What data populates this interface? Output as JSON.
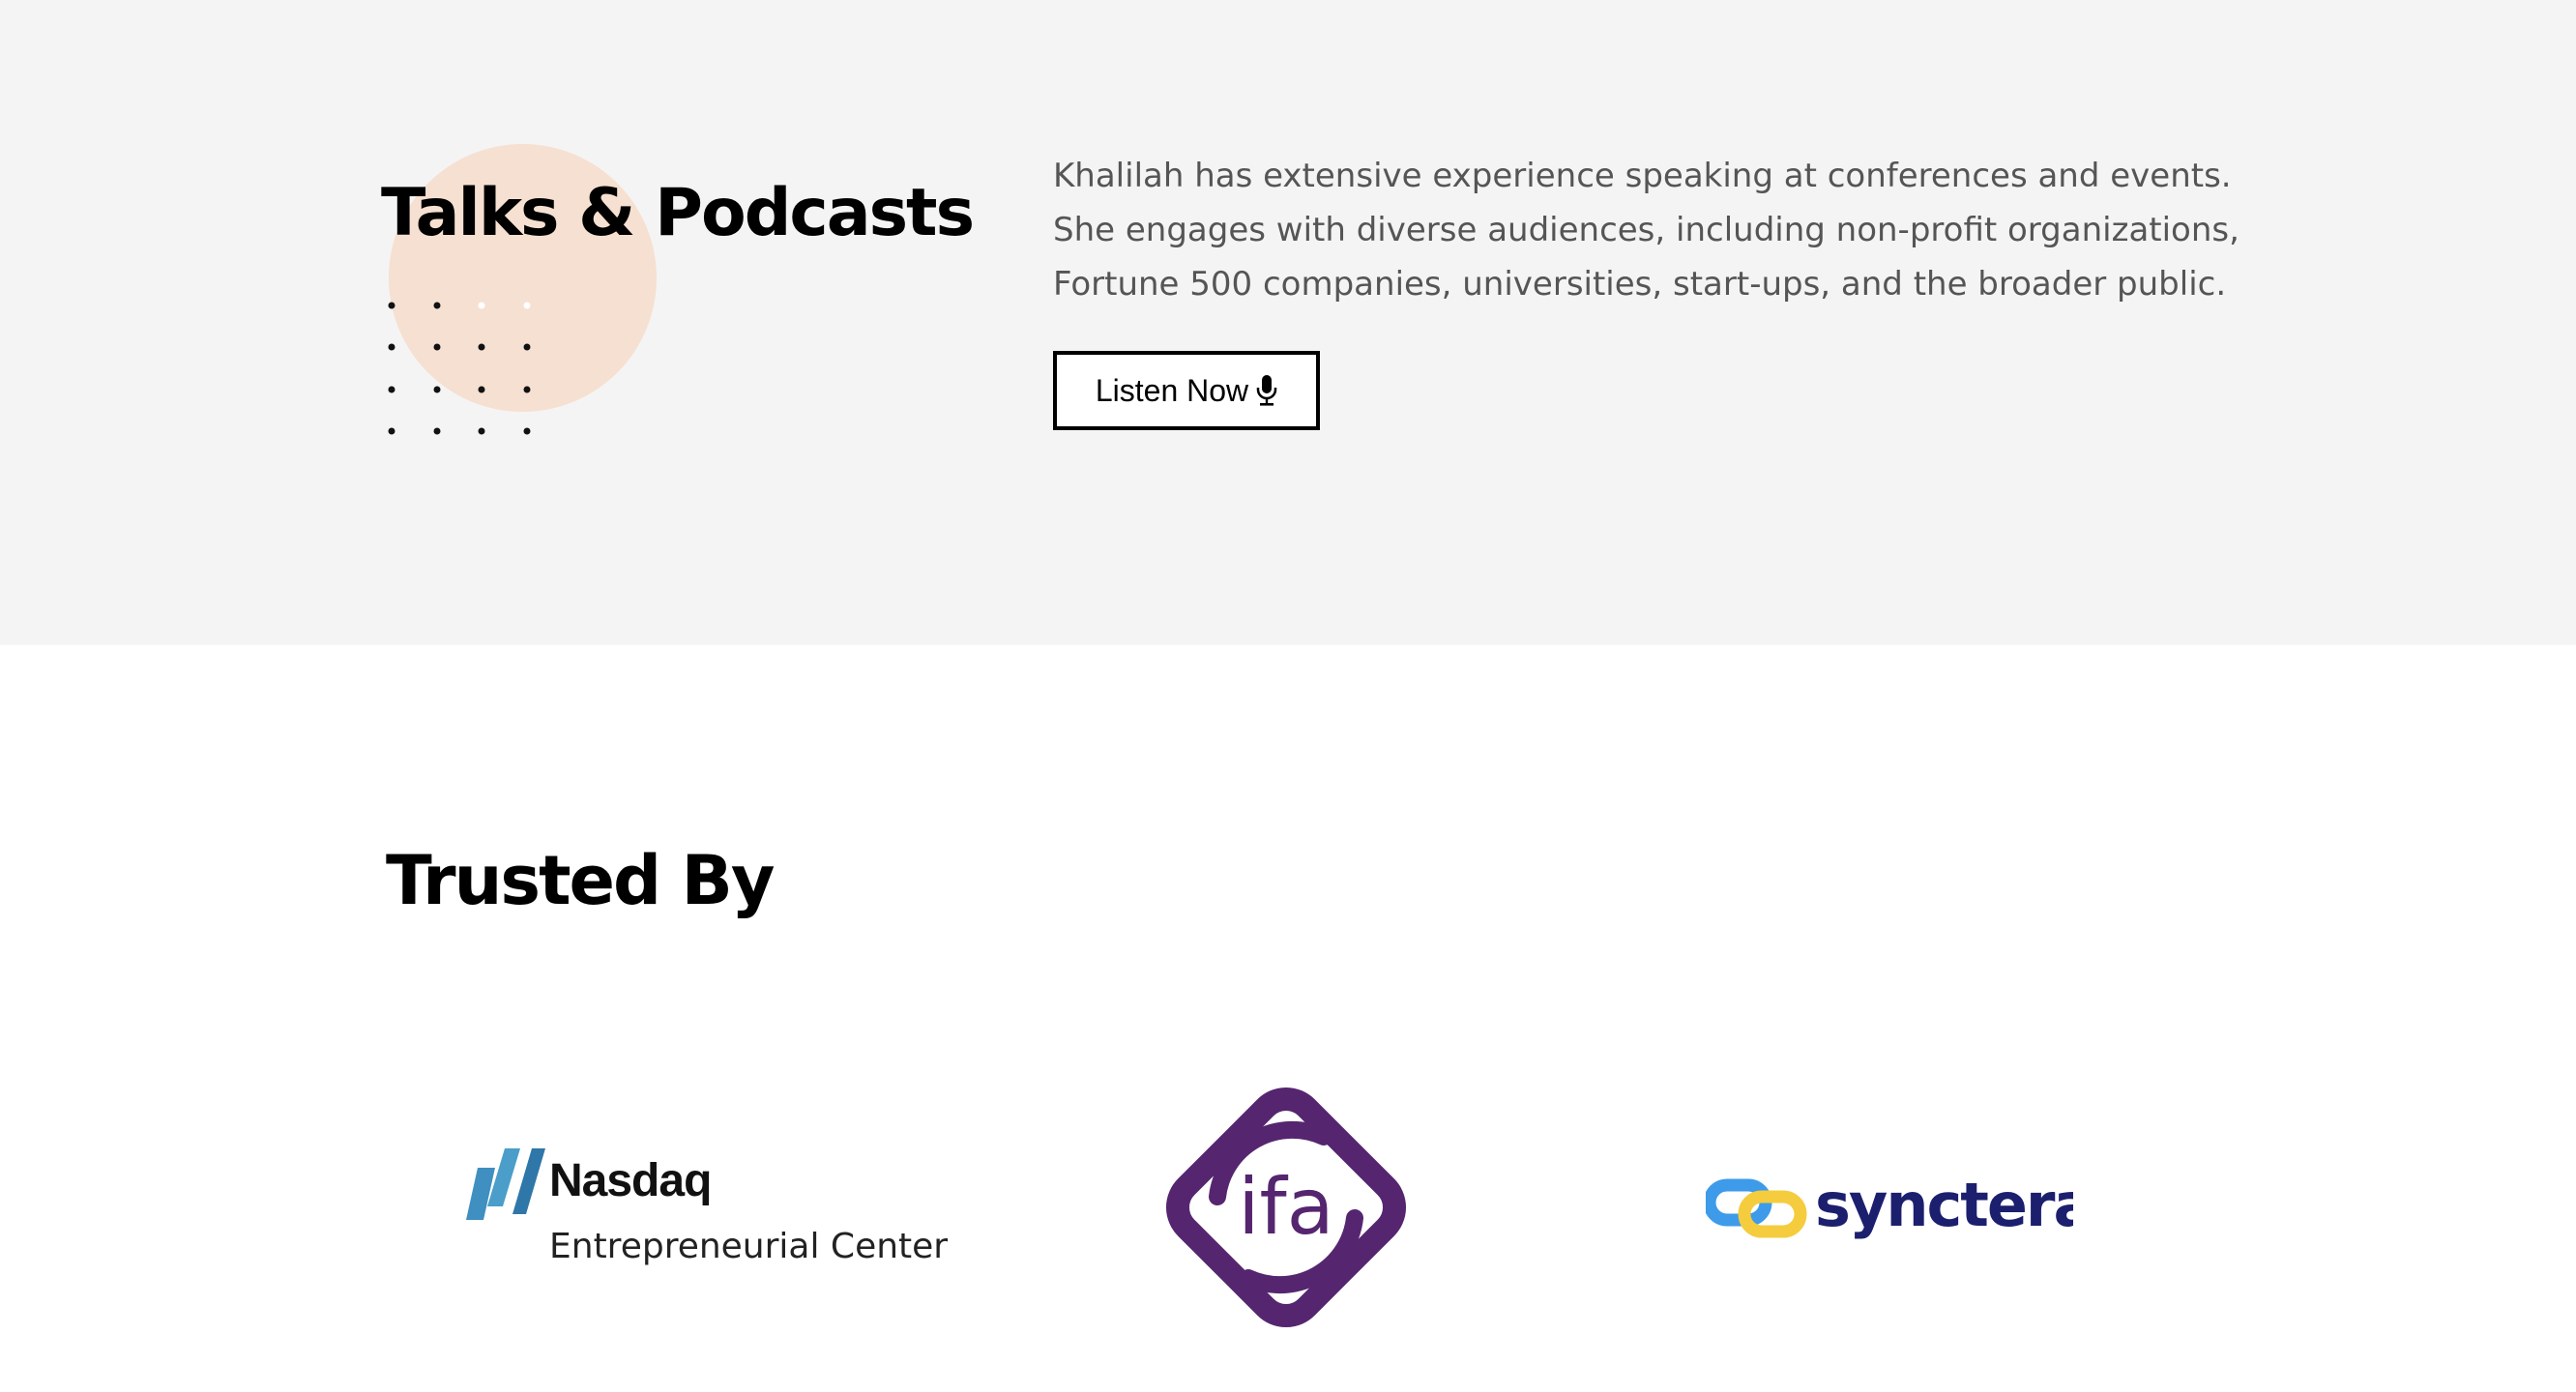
{
  "talks": {
    "title": "Talks & Podcasts",
    "description": "Khalilah has extensive experience speaking at conferences and events. She engages with diverse audiences, including non-profit organizations, Fortune 500 companies, universities, start-ups, and the broader public.",
    "button_label": "Listen Now",
    "button_icon": "microphone-icon",
    "accent_color": "#f6e0d1",
    "background_color": "#f4f4f4"
  },
  "trusted": {
    "title": "Trusted By",
    "logos": [
      {
        "name": "Nasdaq",
        "subtitle": "Entrepreneurial Center",
        "color": "#4a9ec9"
      },
      {
        "name": "ifa",
        "color": "#55266f"
      },
      {
        "name": "synctera",
        "color": "#1b1f6e"
      }
    ]
  }
}
